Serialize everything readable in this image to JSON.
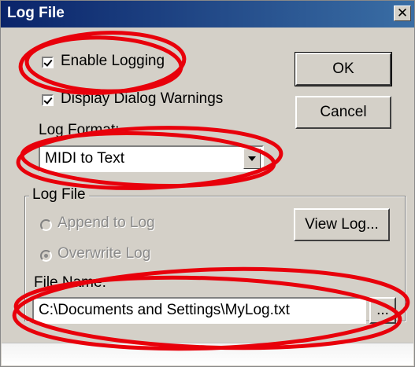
{
  "dialog": {
    "title": "Log File",
    "close_label": "✕"
  },
  "options": {
    "enable_logging": {
      "label": "Enable Logging",
      "checked": true
    },
    "display_warnings": {
      "label": "Display Dialog Warnings",
      "checked": true
    }
  },
  "log_format": {
    "label": "Log Format:",
    "selected": "MIDI to Text"
  },
  "buttons": {
    "ok": "OK",
    "cancel": "Cancel",
    "view_log": "View Log...",
    "browse": "..."
  },
  "log_file_group": {
    "title": "Log File",
    "append_label": "Append to Log",
    "overwrite_label": "Overwrite Log",
    "overwrite_selected": true,
    "file_name_label": "File Name:",
    "file_name_value": "C:\\Documents and Settings\\MyLog.txt"
  },
  "annotations": {
    "highlight_color": "#e8000b"
  }
}
